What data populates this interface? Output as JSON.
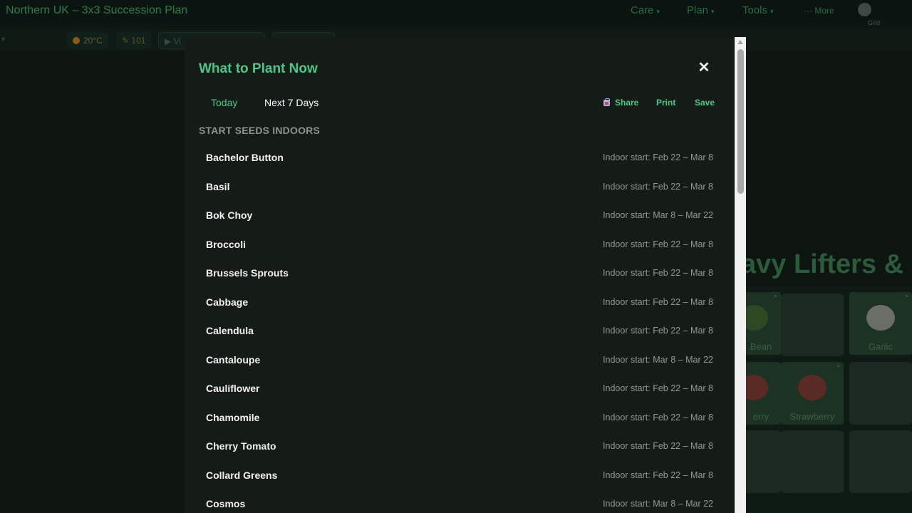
{
  "app": {
    "title": "Northern UK – 3x3 Succession Plan",
    "nav": [
      {
        "label": "Care"
      },
      {
        "label": "Plan"
      },
      {
        "label": "Tools"
      },
      {
        "label": "··· More"
      }
    ],
    "grid_label": "Grid"
  },
  "toolbar": {
    "temperature": "20°C",
    "counter": "101",
    "play_label": "Vi"
  },
  "background": {
    "heading": "avy Lifters & F",
    "cells": [
      {
        "name": "Bean"
      },
      {
        "name": ""
      },
      {
        "name": "Garlic"
      },
      {
        "name": "erry"
      },
      {
        "name": "Strawberry"
      }
    ]
  },
  "modal": {
    "title": "What to Plant Now",
    "close_symbol": "✕",
    "tabs": [
      {
        "label": "Today",
        "active": true
      },
      {
        "label": "Next 7 Days",
        "active": false
      }
    ],
    "actions": {
      "share": "Share",
      "print": "Print",
      "save": "Save"
    },
    "section_heading": "START SEEDS INDOORS",
    "plants": [
      {
        "name": "Bachelor Button",
        "window": "Indoor start: Feb 22 – Mar 8"
      },
      {
        "name": "Basil",
        "window": "Indoor start: Feb 22 – Mar 8"
      },
      {
        "name": "Bok Choy",
        "window": "Indoor start: Mar 8 – Mar 22"
      },
      {
        "name": "Broccoli",
        "window": "Indoor start: Feb 22 – Mar 8"
      },
      {
        "name": "Brussels Sprouts",
        "window": "Indoor start: Feb 22 – Mar 8"
      },
      {
        "name": "Cabbage",
        "window": "Indoor start: Feb 22 – Mar 8"
      },
      {
        "name": "Calendula",
        "window": "Indoor start: Feb 22 – Mar 8"
      },
      {
        "name": "Cantaloupe",
        "window": "Indoor start: Mar 8 – Mar 22"
      },
      {
        "name": "Cauliflower",
        "window": "Indoor start: Feb 22 – Mar 8"
      },
      {
        "name": "Chamomile",
        "window": "Indoor start: Feb 22 – Mar 8"
      },
      {
        "name": "Cherry Tomato",
        "window": "Indoor start: Feb 22 – Mar 8"
      },
      {
        "name": "Collard Greens",
        "window": "Indoor start: Feb 22 – Mar 8"
      },
      {
        "name": "Cosmos",
        "window": "Indoor start: Mar 8 – Mar 22"
      }
    ]
  },
  "colors": {
    "accent": "#4ec68a",
    "modal_bg": "#151c18",
    "page_bg": "#0c150f"
  }
}
